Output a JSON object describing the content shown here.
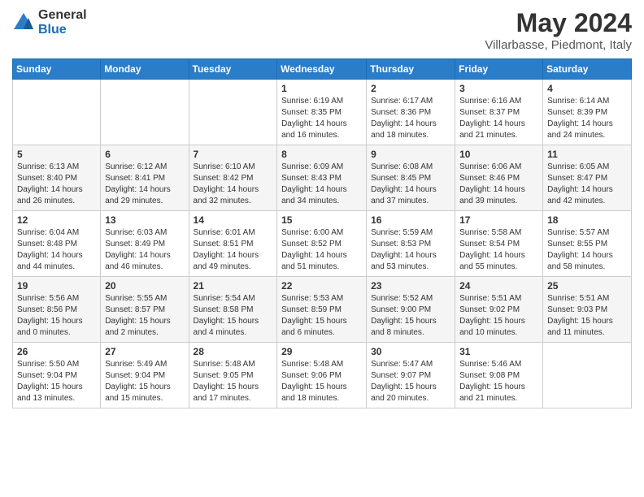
{
  "header": {
    "logo_general": "General",
    "logo_blue": "Blue",
    "month_year": "May 2024",
    "location": "Villarbasse, Piedmont, Italy"
  },
  "weekdays": [
    "Sunday",
    "Monday",
    "Tuesday",
    "Wednesday",
    "Thursday",
    "Friday",
    "Saturday"
  ],
  "weeks": [
    [
      {
        "day": "",
        "info": ""
      },
      {
        "day": "",
        "info": ""
      },
      {
        "day": "",
        "info": ""
      },
      {
        "day": "1",
        "info": "Sunrise: 6:19 AM\nSunset: 8:35 PM\nDaylight: 14 hours\nand 16 minutes."
      },
      {
        "day": "2",
        "info": "Sunrise: 6:17 AM\nSunset: 8:36 PM\nDaylight: 14 hours\nand 18 minutes."
      },
      {
        "day": "3",
        "info": "Sunrise: 6:16 AM\nSunset: 8:37 PM\nDaylight: 14 hours\nand 21 minutes."
      },
      {
        "day": "4",
        "info": "Sunrise: 6:14 AM\nSunset: 8:39 PM\nDaylight: 14 hours\nand 24 minutes."
      }
    ],
    [
      {
        "day": "5",
        "info": "Sunrise: 6:13 AM\nSunset: 8:40 PM\nDaylight: 14 hours\nand 26 minutes."
      },
      {
        "day": "6",
        "info": "Sunrise: 6:12 AM\nSunset: 8:41 PM\nDaylight: 14 hours\nand 29 minutes."
      },
      {
        "day": "7",
        "info": "Sunrise: 6:10 AM\nSunset: 8:42 PM\nDaylight: 14 hours\nand 32 minutes."
      },
      {
        "day": "8",
        "info": "Sunrise: 6:09 AM\nSunset: 8:43 PM\nDaylight: 14 hours\nand 34 minutes."
      },
      {
        "day": "9",
        "info": "Sunrise: 6:08 AM\nSunset: 8:45 PM\nDaylight: 14 hours\nand 37 minutes."
      },
      {
        "day": "10",
        "info": "Sunrise: 6:06 AM\nSunset: 8:46 PM\nDaylight: 14 hours\nand 39 minutes."
      },
      {
        "day": "11",
        "info": "Sunrise: 6:05 AM\nSunset: 8:47 PM\nDaylight: 14 hours\nand 42 minutes."
      }
    ],
    [
      {
        "day": "12",
        "info": "Sunrise: 6:04 AM\nSunset: 8:48 PM\nDaylight: 14 hours\nand 44 minutes."
      },
      {
        "day": "13",
        "info": "Sunrise: 6:03 AM\nSunset: 8:49 PM\nDaylight: 14 hours\nand 46 minutes."
      },
      {
        "day": "14",
        "info": "Sunrise: 6:01 AM\nSunset: 8:51 PM\nDaylight: 14 hours\nand 49 minutes."
      },
      {
        "day": "15",
        "info": "Sunrise: 6:00 AM\nSunset: 8:52 PM\nDaylight: 14 hours\nand 51 minutes."
      },
      {
        "day": "16",
        "info": "Sunrise: 5:59 AM\nSunset: 8:53 PM\nDaylight: 14 hours\nand 53 minutes."
      },
      {
        "day": "17",
        "info": "Sunrise: 5:58 AM\nSunset: 8:54 PM\nDaylight: 14 hours\nand 55 minutes."
      },
      {
        "day": "18",
        "info": "Sunrise: 5:57 AM\nSunset: 8:55 PM\nDaylight: 14 hours\nand 58 minutes."
      }
    ],
    [
      {
        "day": "19",
        "info": "Sunrise: 5:56 AM\nSunset: 8:56 PM\nDaylight: 15 hours\nand 0 minutes."
      },
      {
        "day": "20",
        "info": "Sunrise: 5:55 AM\nSunset: 8:57 PM\nDaylight: 15 hours\nand 2 minutes."
      },
      {
        "day": "21",
        "info": "Sunrise: 5:54 AM\nSunset: 8:58 PM\nDaylight: 15 hours\nand 4 minutes."
      },
      {
        "day": "22",
        "info": "Sunrise: 5:53 AM\nSunset: 8:59 PM\nDaylight: 15 hours\nand 6 minutes."
      },
      {
        "day": "23",
        "info": "Sunrise: 5:52 AM\nSunset: 9:00 PM\nDaylight: 15 hours\nand 8 minutes."
      },
      {
        "day": "24",
        "info": "Sunrise: 5:51 AM\nSunset: 9:02 PM\nDaylight: 15 hours\nand 10 minutes."
      },
      {
        "day": "25",
        "info": "Sunrise: 5:51 AM\nSunset: 9:03 PM\nDaylight: 15 hours\nand 11 minutes."
      }
    ],
    [
      {
        "day": "26",
        "info": "Sunrise: 5:50 AM\nSunset: 9:04 PM\nDaylight: 15 hours\nand 13 minutes."
      },
      {
        "day": "27",
        "info": "Sunrise: 5:49 AM\nSunset: 9:04 PM\nDaylight: 15 hours\nand 15 minutes."
      },
      {
        "day": "28",
        "info": "Sunrise: 5:48 AM\nSunset: 9:05 PM\nDaylight: 15 hours\nand 17 minutes."
      },
      {
        "day": "29",
        "info": "Sunrise: 5:48 AM\nSunset: 9:06 PM\nDaylight: 15 hours\nand 18 minutes."
      },
      {
        "day": "30",
        "info": "Sunrise: 5:47 AM\nSunset: 9:07 PM\nDaylight: 15 hours\nand 20 minutes."
      },
      {
        "day": "31",
        "info": "Sunrise: 5:46 AM\nSunset: 9:08 PM\nDaylight: 15 hours\nand 21 minutes."
      },
      {
        "day": "",
        "info": ""
      }
    ]
  ]
}
